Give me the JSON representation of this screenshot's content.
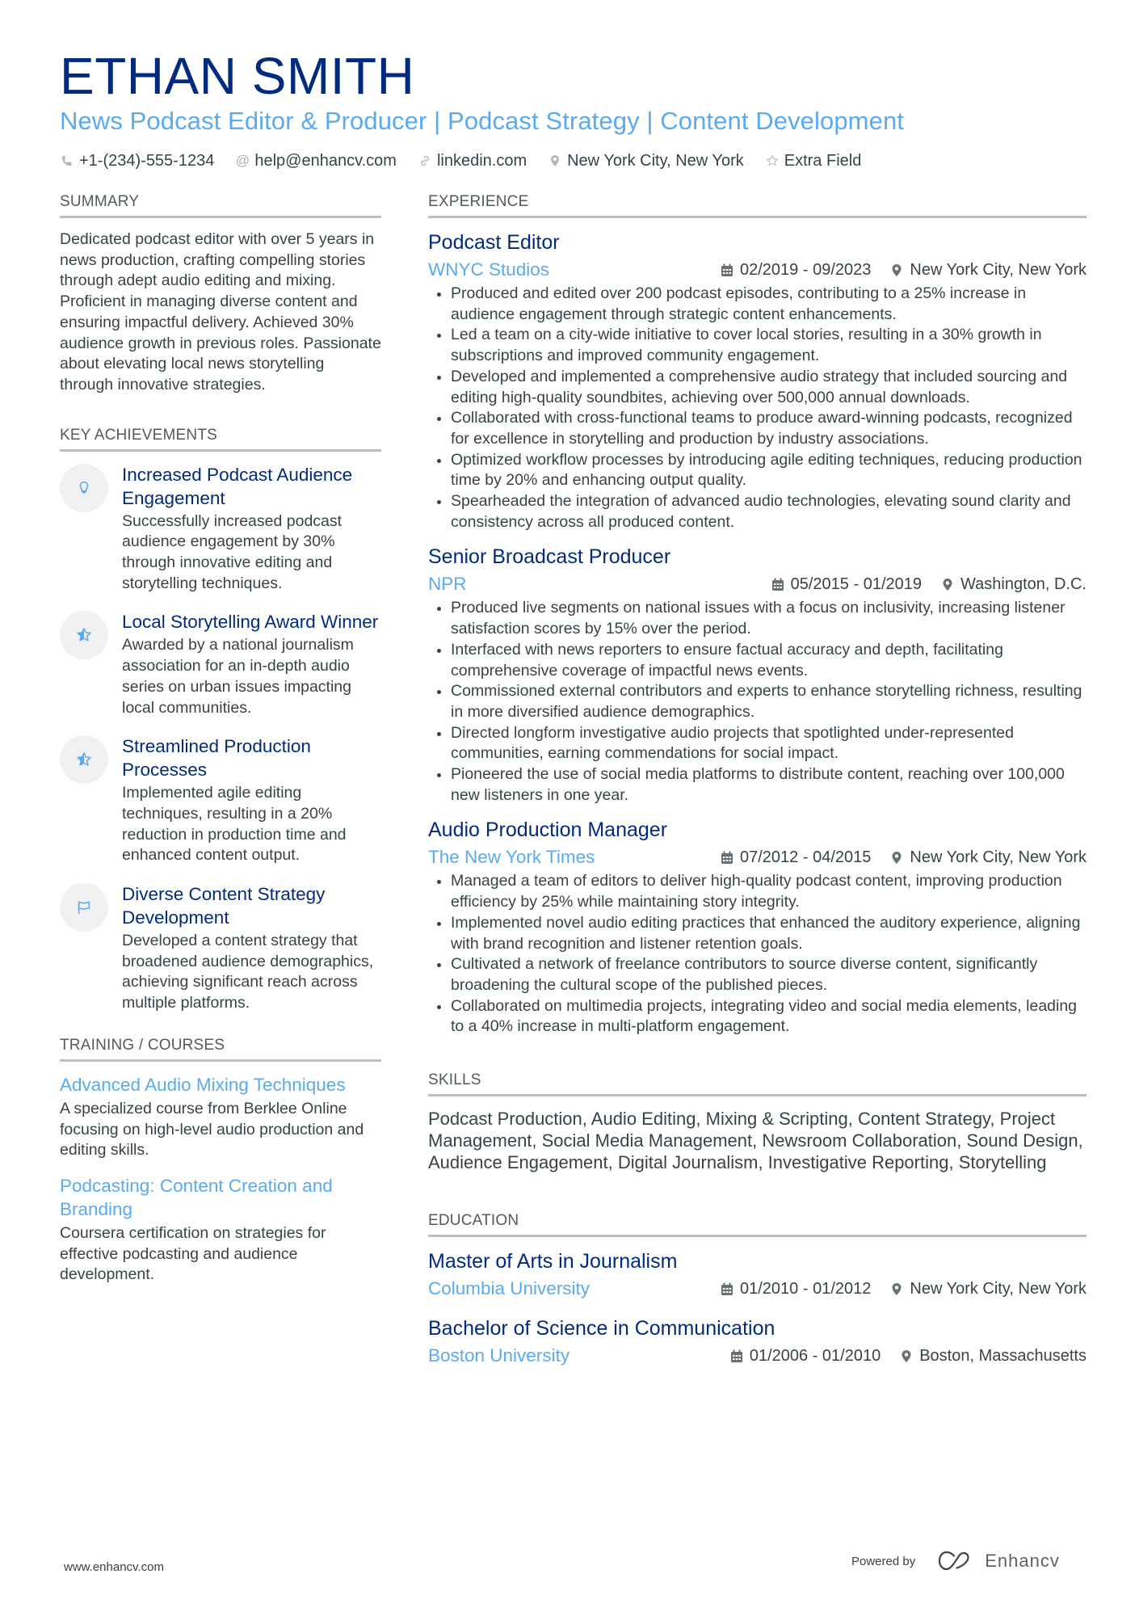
{
  "header": {
    "name": "ETHAN SMITH",
    "title": "News Podcast Editor & Producer | Podcast Strategy | Content Development",
    "contacts": [
      {
        "icon": "phone-icon",
        "text": "+1-(234)-555-1234"
      },
      {
        "icon": "at-icon",
        "text": "help@enhancv.com"
      },
      {
        "icon": "link-icon",
        "text": "linkedin.com"
      },
      {
        "icon": "location-pin-icon",
        "text": "New York City, New York"
      },
      {
        "icon": "star-icon",
        "text": "Extra Field"
      }
    ]
  },
  "colors": {
    "name": "#002b7f",
    "accent": "#5aaaf0",
    "text": "#384347",
    "rule": "#bcbfc2",
    "icon_bg": "#f0f1f2"
  },
  "summary": {
    "heading": "SUMMARY",
    "text": "Dedicated podcast editor with over 5 years in news production, crafting compelling stories through adept audio editing and mixing. Proficient in managing diverse content and ensuring impactful delivery. Achieved 30% audience growth in previous roles. Passionate about elevating local news storytelling through innovative strategies."
  },
  "achievements": {
    "heading": "KEY ACHIEVEMENTS",
    "items": [
      {
        "icon": "lightbulb-icon",
        "title": "Increased Podcast Audience Engagement",
        "text": "Successfully increased podcast audience engagement by 30% through innovative editing and storytelling techniques."
      },
      {
        "icon": "half-star-icon",
        "title": "Local Storytelling Award Winner",
        "text": "Awarded by a national journalism association for an in-depth audio series on urban issues impacting local communities."
      },
      {
        "icon": "half-star-icon",
        "title": "Streamlined Production Processes",
        "text": "Implemented agile editing techniques, resulting in a 20% reduction in production time and enhanced content output."
      },
      {
        "icon": "flag-icon",
        "title": "Diverse Content Strategy Development",
        "text": "Developed a content strategy that broadened audience demographics, achieving significant reach across multiple platforms."
      }
    ]
  },
  "training": {
    "heading": "TRAINING / COURSES",
    "items": [
      {
        "title": "Advanced Audio Mixing Techniques",
        "text": "A specialized course from Berklee Online focusing on high-level audio production and editing skills."
      },
      {
        "title": "Podcasting: Content Creation and Branding",
        "text": "Coursera certification on strategies for effective podcasting and audience development."
      }
    ]
  },
  "experience": {
    "heading": "EXPERIENCE",
    "jobs": [
      {
        "title": "Podcast Editor",
        "company": "WNYC Studios",
        "dates": "02/2019 - 09/2023",
        "location": "New York City, New York",
        "bullets": [
          "Produced and edited over 200 podcast episodes, contributing to a 25% increase in audience engagement through strategic content enhancements.",
          "Led a team on a city-wide initiative to cover local stories, resulting in a 30% growth in subscriptions and improved community engagement.",
          "Developed and implemented a comprehensive audio strategy that included sourcing and editing high-quality soundbites, achieving over 500,000 annual downloads.",
          "Collaborated with cross-functional teams to produce award-winning podcasts, recognized for excellence in storytelling and production by industry associations.",
          "Optimized workflow processes by introducing agile editing techniques, reducing production time by 20% and enhancing output quality.",
          "Spearheaded the integration of advanced audio technologies, elevating sound clarity and consistency across all produced content."
        ]
      },
      {
        "title": "Senior Broadcast Producer",
        "company": "NPR",
        "dates": "05/2015 - 01/2019",
        "location": "Washington, D.C.",
        "bullets": [
          "Produced live segments on national issues with a focus on inclusivity, increasing listener satisfaction scores by 15% over the period.",
          "Interfaced with news reporters to ensure factual accuracy and depth, facilitating comprehensive coverage of impactful news events.",
          "Commissioned external contributors and experts to enhance storytelling richness, resulting in more diversified audience demographics.",
          "Directed longform investigative audio projects that spotlighted under-represented communities, earning commendations for social impact.",
          "Pioneered the use of social media platforms to distribute content, reaching over 100,000 new listeners in one year."
        ]
      },
      {
        "title": "Audio Production Manager",
        "company": "The New York Times",
        "dates": "07/2012 - 04/2015",
        "location": "New York City, New York",
        "bullets": [
          "Managed a team of editors to deliver high-quality podcast content, improving production efficiency by 25% while maintaining story integrity.",
          "Implemented novel audio editing practices that enhanced the auditory experience, aligning with brand recognition and listener retention goals.",
          "Cultivated a network of freelance contributors to source diverse content, significantly broadening the cultural scope of the published pieces.",
          "Collaborated on multimedia projects, integrating video and social media elements, leading to a 40% increase in multi-platform engagement."
        ]
      }
    ]
  },
  "skills": {
    "heading": "SKILLS",
    "text": "Podcast Production, Audio Editing, Mixing & Scripting, Content Strategy, Project Management, Social Media Management, Newsroom Collaboration, Sound Design, Audience Engagement, Digital Journalism, Investigative Reporting, Storytelling"
  },
  "education": {
    "heading": "EDUCATION",
    "items": [
      {
        "degree": "Master of Arts in Journalism",
        "school": "Columbia University",
        "dates": "01/2010 - 01/2012",
        "location": "New York City, New York"
      },
      {
        "degree": "Bachelor of Science in Communication",
        "school": "Boston University",
        "dates": "01/2006 - 01/2010",
        "location": "Boston, Massachusetts"
      }
    ]
  },
  "footer": {
    "website": "www.enhancv.com",
    "powered_by": "Powered by",
    "brand": "Enhancv"
  }
}
